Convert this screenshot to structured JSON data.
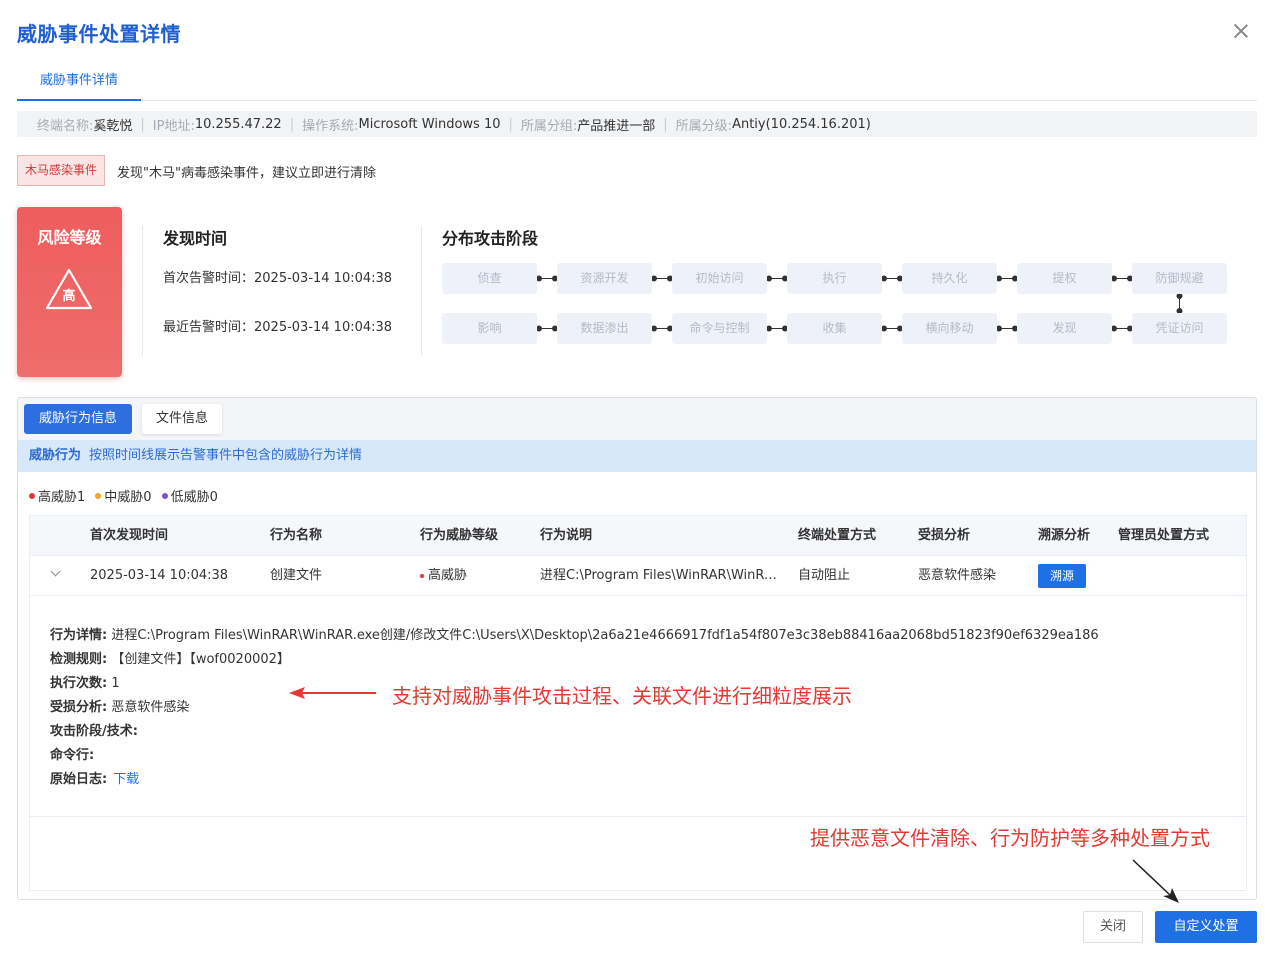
{
  "dialog": {
    "title": "威胁事件处置详情",
    "tab_label": "威胁事件详情"
  },
  "terminal": {
    "name_label": "终端名称:",
    "name_value": "奚乾悦",
    "ip_label": "IP地址:",
    "ip_value": "10.255.47.22",
    "os_label": "操作系统:",
    "os_value": "Microsoft Windows 10",
    "group_label": "所属分组:",
    "group_value": "产品推进一部",
    "level_label": "所属分级:",
    "level_value": "Antiy(10.254.16.201)"
  },
  "event": {
    "tag": "木马感染事件",
    "description": "发现\"木马\"病毒感染事件，建议立即进行清除"
  },
  "risk": {
    "title": "风险等级",
    "level": "高"
  },
  "discovery": {
    "title": "发现时间",
    "first_alert": "首次告警时间：2025-03-14 10:04:38",
    "last_alert": "最近告警时间：2025-03-14 10:04:38"
  },
  "stages": {
    "title": "分布攻击阶段",
    "row1": [
      "侦查",
      "资源开发",
      "初始访问",
      "执行",
      "持久化",
      "提权",
      "防御规避"
    ],
    "row2": [
      "影响",
      "数据渗出",
      "命令与控制",
      "收集",
      "横向移动",
      "发现",
      "凭证访问"
    ]
  },
  "panel": {
    "tab_behavior": "威胁行为信息",
    "tab_file": "文件信息",
    "notice_title": "威胁行为",
    "notice_text": "按照时间线展示告警事件中包含的威胁行为详情"
  },
  "legend": {
    "high": "高威胁1",
    "medium": "中威胁0",
    "low": "低威胁0",
    "colors": {
      "high": "#d63b3b",
      "medium": "#f5a623",
      "low": "#7b4fd6"
    }
  },
  "table": {
    "headers": [
      "首次发现时间",
      "行为名称",
      "行为威胁等级",
      "行为说明",
      "终端处置方式",
      "受损分析",
      "溯源分析",
      "管理员处置方式"
    ],
    "row": {
      "time": "2025-03-14 10:04:38",
      "name": "创建文件",
      "level": "高威胁",
      "desc": "进程C:\\Program Files\\WinRAR\\WinRAR.exe创建/修改文件",
      "terminal_action": "自动阻止",
      "damage": "恶意软件感染",
      "trace_button": "溯源",
      "admin_action": ""
    }
  },
  "detail": {
    "behavior_label": "行为详情:",
    "behavior_value": "进程C:\\Program Files\\WinRAR\\WinRAR.exe创建/修改文件C:\\Users\\X\\Desktop\\2a6a21e4666917fdf1a54f807e3c38eb88416aa2068bd51823f90ef6329ea186",
    "rule_label": "检测规则:",
    "rule_value": "【创建文件】【wof0020002】",
    "count_label": "执行次数:",
    "count_value": "1",
    "damage_label": "受损分析:",
    "damage_value": "恶意软件感染",
    "stage_label": "攻击阶段/技术:",
    "cmd_label": "命令行:",
    "log_label": "原始日志:",
    "log_link": "下载"
  },
  "annotations": {
    "left": "支持对威胁事件攻击过程、关联文件进行细粒度展示",
    "right": "提供恶意文件清除、行为防护等多种处置方式"
  },
  "footer": {
    "close_label": "关闭",
    "custom_label": "自定义处置"
  }
}
